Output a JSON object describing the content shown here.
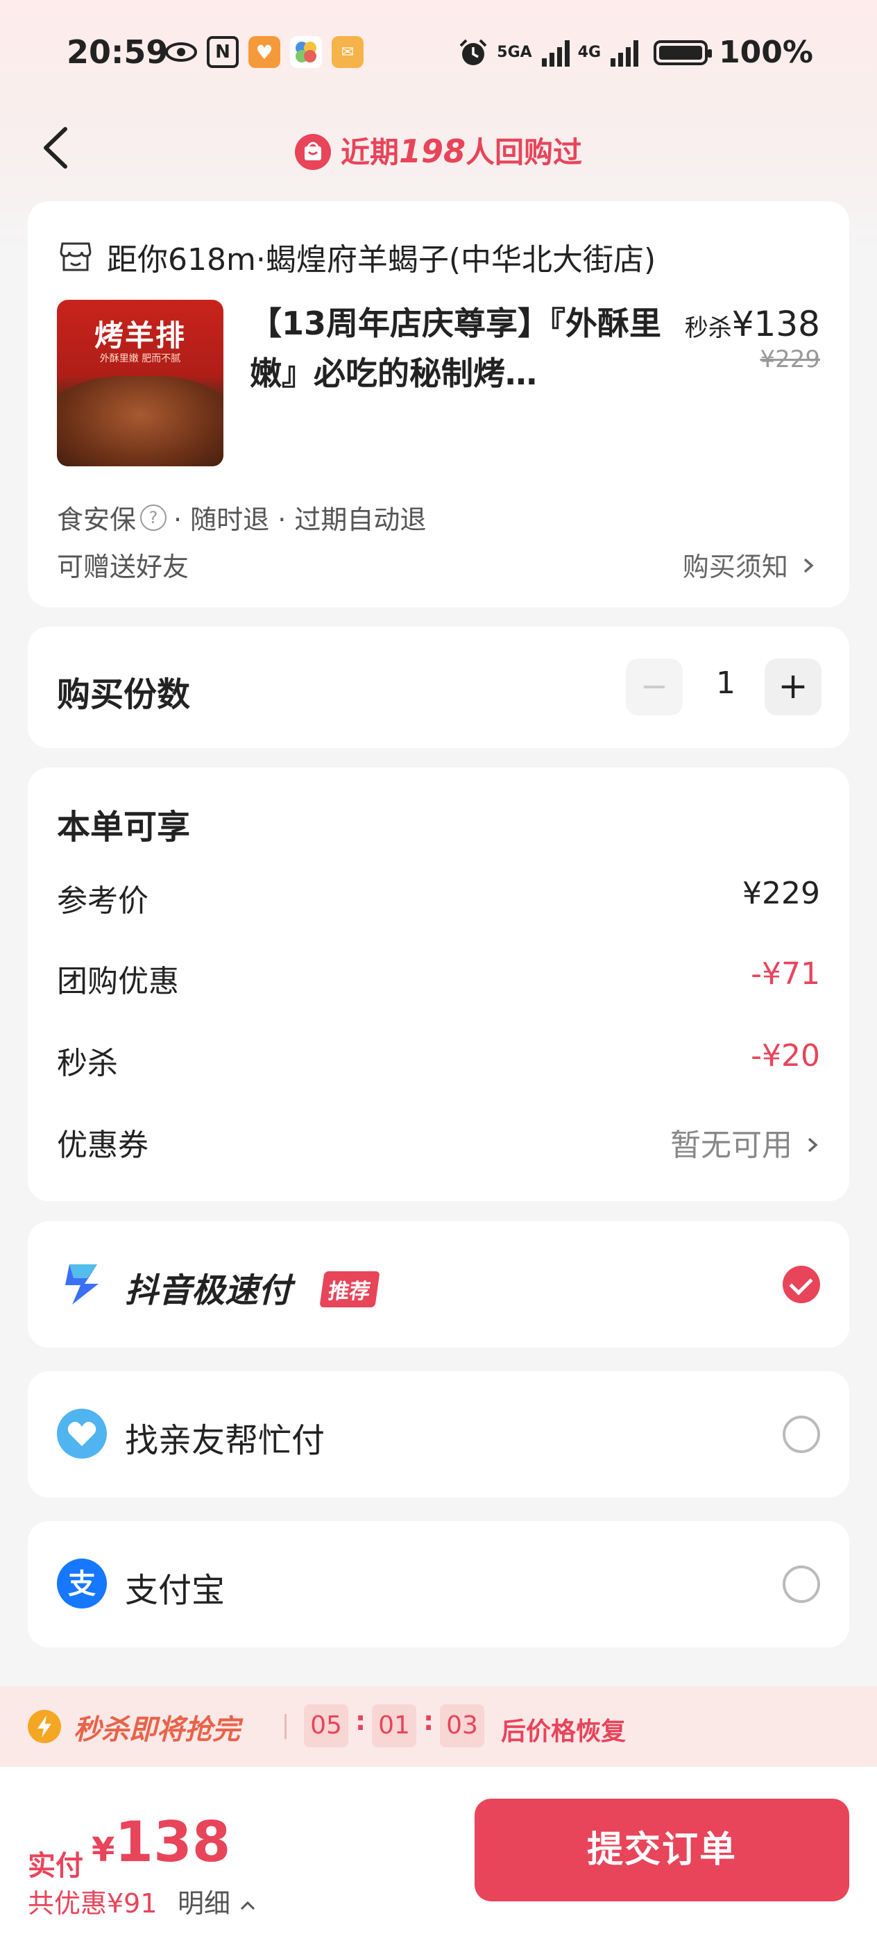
{
  "status_bar": {
    "time": "20:59",
    "net1": "5GA",
    "net2": "4G",
    "battery": "100%"
  },
  "nav": {
    "prefix": "近期",
    "count": "198",
    "suffix": "人回购过"
  },
  "store": {
    "name": "距你618m·蝎煌府羊蝎子(中华北大街店)"
  },
  "deal": {
    "image_title": "烤羊排",
    "image_subtitle": "外酥里嫩  肥而不腻",
    "title": "【13周年店庆尊享】『外酥里嫩』必吃的秘制烤…",
    "price_label": "秒杀",
    "price": "¥138",
    "original_price": "¥229",
    "tag1": "食安保",
    "tag_rest": "· 随时退 · 过期自动退",
    "gift": "可赠送好友",
    "notice": "购买须知"
  },
  "quantity": {
    "label": "购买份数",
    "value": "1",
    "minus": "−",
    "plus": "+"
  },
  "discounts": {
    "title": "本单可享",
    "rows": [
      {
        "label": "参考价",
        "value": "¥229"
      },
      {
        "label": "团购优惠",
        "value": "-¥71"
      },
      {
        "label": "秒杀",
        "value": "-¥20"
      },
      {
        "label": "优惠券",
        "value": "暂无可用"
      }
    ]
  },
  "payments": [
    {
      "label": "抖音极速付",
      "badge": "推荐",
      "selected": true
    },
    {
      "label": "找亲友帮忙付",
      "selected": false
    },
    {
      "label": "支付宝",
      "selected": false
    }
  ],
  "flash_sale": {
    "title": "秒杀即将抢完",
    "hours": "05",
    "minutes": "01",
    "seconds": "03",
    "tail": "后价格恢复"
  },
  "footer": {
    "pay_label": "实付",
    "currency": "¥",
    "amount": "138",
    "saved": "共优惠¥91",
    "detail": "明细",
    "submit": "提交订单"
  },
  "colors": {
    "accent": "#e8445a",
    "flash_orange": "#e8634a"
  }
}
